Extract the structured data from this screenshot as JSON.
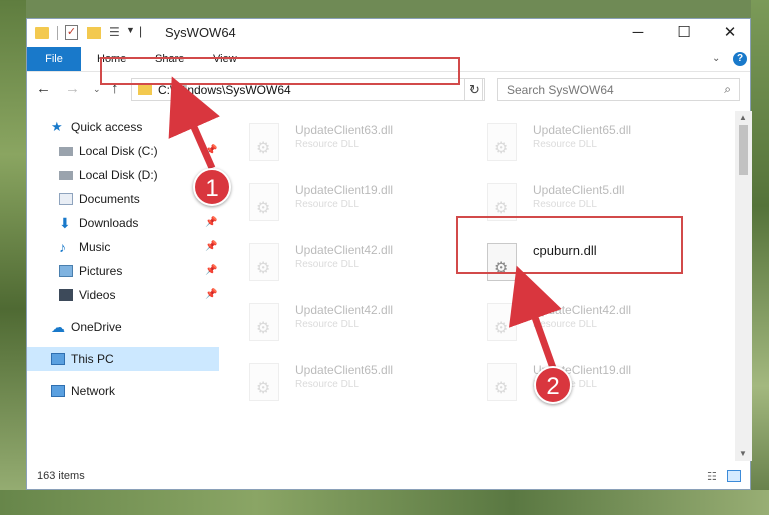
{
  "window": {
    "title": "SysWOW64",
    "minimize_label": "─",
    "maximize_label": "☐",
    "close_label": "✕"
  },
  "ribbon": {
    "tabs": [
      "File",
      "Home",
      "Share",
      "View"
    ],
    "help_label": "?"
  },
  "nav": {
    "address": "C:\\Windows\\SysWOW64",
    "search_placeholder": "Search SysWOW64"
  },
  "sidebar": {
    "items": [
      {
        "label": "Quick access",
        "icon": "star-icon",
        "pinned": false
      },
      {
        "label": "Local Disk (C:)",
        "icon": "drive-icon",
        "pinned": true
      },
      {
        "label": "Local Disk (D:)",
        "icon": "drive-icon",
        "pinned": true
      },
      {
        "label": "Documents",
        "icon": "documents-icon",
        "pinned": true
      },
      {
        "label": "Downloads",
        "icon": "download-icon",
        "pinned": true
      },
      {
        "label": "Music",
        "icon": "music-icon",
        "pinned": true
      },
      {
        "label": "Pictures",
        "icon": "pictures-icon",
        "pinned": true
      },
      {
        "label": "Videos",
        "icon": "videos-icon",
        "pinned": true
      },
      {
        "label": "OneDrive",
        "icon": "cloud-icon",
        "pinned": false
      },
      {
        "label": "This PC",
        "icon": "computer-icon",
        "pinned": false,
        "selected": true
      },
      {
        "label": "Network",
        "icon": "network-icon",
        "pinned": false
      }
    ]
  },
  "files": [
    {
      "name": "UpdateClient63.dll",
      "type": "Resource DLL"
    },
    {
      "name": "UpdateClient65.dll",
      "type": "Resource DLL"
    },
    {
      "name": "UpdateClient19.dll",
      "type": "Resource DLL"
    },
    {
      "name": "UpdateClient5.dll",
      "type": "Resource DLL"
    },
    {
      "name": "UpdateClient42.dll",
      "type": "Resource DLL"
    },
    {
      "name": "cpuburn.dll",
      "type": ""
    },
    {
      "name": "UpdateClient42.dll",
      "type": "Resource DLL"
    },
    {
      "name": "UpdateClient42.dll",
      "type": "Resource DLL"
    },
    {
      "name": "UpdateClient65.dll",
      "type": "Resource DLL"
    },
    {
      "name": "UpdateClient19.dll",
      "type": "Resource DLL"
    }
  ],
  "status": {
    "item_count": "163 items"
  },
  "annotations": {
    "step1": "1",
    "step2": "2",
    "color": "#d9363e"
  }
}
